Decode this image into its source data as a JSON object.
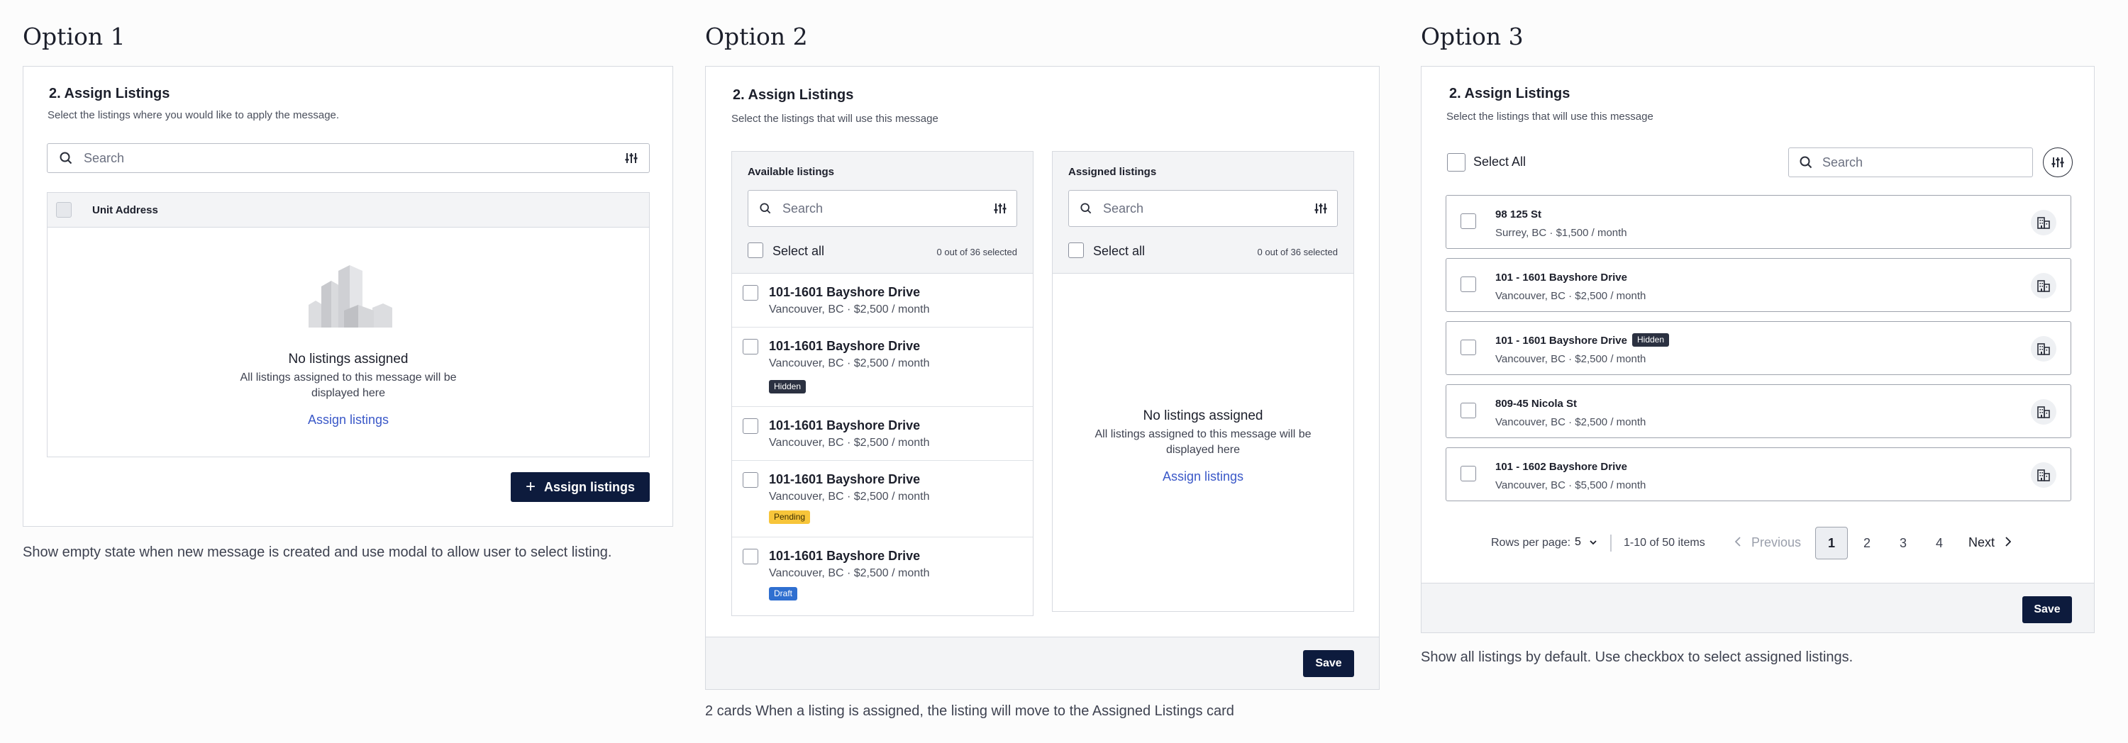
{
  "opt1": {
    "heading": "Option 1",
    "section_title": "2. Assign Listings",
    "section_subtitle": "Select the listings where you would like to apply the message.",
    "search_placeholder": "Search",
    "table_header": "Unit Address",
    "empty_title": "No listings assigned",
    "empty_desc_line1": "All listings assigned to this message will be",
    "empty_desc_line2": "displayed here",
    "empty_link": "Assign listings",
    "primary_button": "Assign listings",
    "caption": "Show empty state when new message is created and use modal to allow user to select listing."
  },
  "opt2": {
    "heading": "Option 2",
    "section_title": "2. Assign Listings",
    "section_subtitle": "Select the listings that will use this message",
    "available": {
      "title": "Available listings",
      "search_placeholder": "Search",
      "select_all": "Select all",
      "count": "0 out of 36 selected",
      "items": [
        {
          "title": "101-1601 Bayshore Drive",
          "sub": "Vancouver, BC · $2,500 / month",
          "badge": ""
        },
        {
          "title": "101-1601 Bayshore Drive",
          "sub": "Vancouver, BC · $2,500 / month",
          "badge": "Hidden"
        },
        {
          "title": "101-1601 Bayshore Drive",
          "sub": "Vancouver, BC · $2,500 / month",
          "badge": ""
        },
        {
          "title": "101-1601 Bayshore Drive",
          "sub": "Vancouver, BC · $2,500 / month",
          "badge": "Pending"
        },
        {
          "title": "101-1601 Bayshore Drive",
          "sub": "Vancouver, BC · $2,500 / month",
          "badge": "Draft"
        }
      ]
    },
    "assigned": {
      "title": "Assigned listings",
      "search_placeholder": "Search",
      "select_all": "Select all",
      "count": "0 out of 36 selected",
      "empty_title": "No listings assigned",
      "empty_desc_line1": "All listings assigned to this message will be",
      "empty_desc_line2": "displayed here",
      "empty_link": "Assign listings"
    },
    "save_button": "Save",
    "caption": "2 cards When a listing is assigned, the listing will move to the Assigned Listings card"
  },
  "opt3": {
    "heading": "Option 3",
    "section_title": "2. Assign Listings",
    "section_subtitle": "Select the listings that will use this message",
    "select_all": "Select All",
    "search_placeholder": "Search",
    "items": [
      {
        "title": "98 125 St",
        "sub": "Surrey, BC · $1,500 / month",
        "badge": ""
      },
      {
        "title": "101 - 1601 Bayshore Drive",
        "sub": "Vancouver, BC · $2,500 / month",
        "badge": ""
      },
      {
        "title": "101 - 1601 Bayshore Drive",
        "sub": "Vancouver, BC · $2,500 / month",
        "badge": "Hidden"
      },
      {
        "title": "809-45 Nicola St",
        "sub": "Vancouver, BC · $2,500 / month",
        "badge": ""
      },
      {
        "title": "101 - 1602 Bayshore Drive",
        "sub": "Vancouver, BC · $5,500 / month",
        "badge": ""
      }
    ],
    "pagination": {
      "rows_label": "Rows per page:",
      "rows_value": "5",
      "range": "1-10 of 50 items",
      "previous": "Previous",
      "pages": [
        "1",
        "2",
        "3",
        "4"
      ],
      "next": "Next"
    },
    "save_button": "Save",
    "caption": "Show all listings by default. Use checkbox to select assigned listings."
  },
  "colors": {
    "primary": "#0d1b3d",
    "link": "#3a58c8",
    "hidden": "#2b3141",
    "pending": "#f7c53a",
    "draft": "#2f6fd0"
  }
}
